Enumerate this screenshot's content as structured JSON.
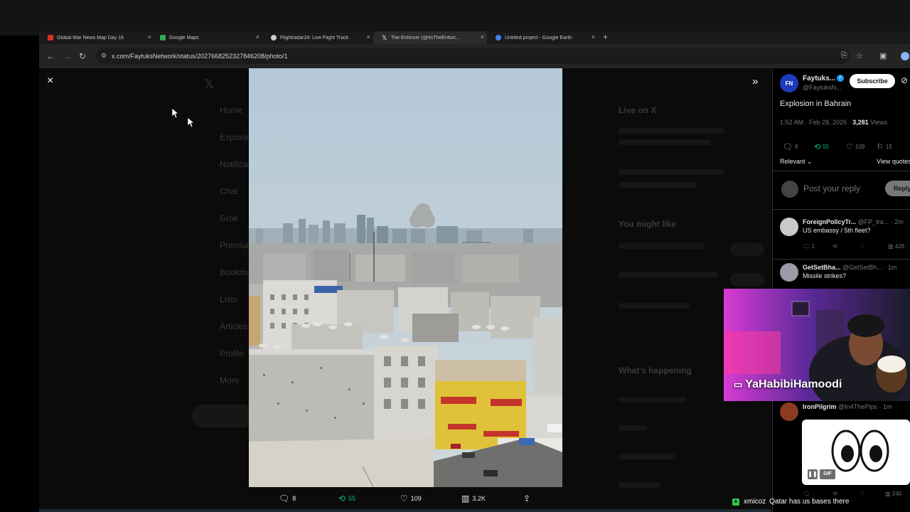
{
  "browser": {
    "tabs": [
      {
        "label": "Global War News Map Day 16",
        "color": "#d93025",
        "active": false
      },
      {
        "label": "Google Maps",
        "color": "#34a853",
        "active": false
      },
      {
        "label": "Flightradar24: Live Flight Track",
        "color": "#cccccc",
        "active": false
      },
      {
        "label": "The Enforcer (@ItsTheEnforcer)",
        "color": "#ffffff",
        "active": true
      },
      {
        "label": "Untitled project - Google Earth",
        "color": "#4285f4",
        "active": false
      }
    ],
    "new_tab": "+",
    "url": "x.com/FaytuksNetwork/status/2027668252327846208/photo/1"
  },
  "viewer": {
    "close_icon": "×",
    "expand_icon": "»",
    "photo_alt": "Explosion in Bahrain",
    "actions": {
      "replies": "8",
      "reposts": "55",
      "likes": "109",
      "views": "3.2K"
    }
  },
  "post": {
    "avatar_text": "FN",
    "author": "Faytuks...",
    "handle": "@FaytuksN...",
    "subscribe": "Subscribe",
    "text": "Explosion in Bahrain",
    "time": "1:52 AM · Feb 28, 2026 · ",
    "views_count": "3,281",
    "views_label": " Views",
    "stats": {
      "replies": "8",
      "reposts": "55",
      "likes": "109",
      "bookmarks": "15"
    },
    "sort_label": "Relevant ⌄",
    "view_quotes": "View quotes",
    "reply_placeholder": "Post your reply",
    "reply_button": "Reply"
  },
  "replies": [
    {
      "name": "ForeignPolicyTr...",
      "handle": "@FP_tra...",
      "time": "· 2m",
      "text": "US embassy / 5th fleet?",
      "replies": "1",
      "likes": "",
      "views": "428",
      "avatar_color": "#c9c9c9"
    },
    {
      "name": "GetSetBha...",
      "handle": "@GetSetBh...",
      "time": "· 1m",
      "text": "Missile strikes?",
      "replies": "",
      "likes": "",
      "views": "",
      "avatar_color": "#9a9aa8"
    },
    {
      "name": "IronPilgrim",
      "handle": "@In4ThePips",
      "time": "· 1m",
      "text": "",
      "replies": "",
      "likes": "",
      "views": "240",
      "avatar_color": "#8a3b22"
    }
  ],
  "overlay": {
    "streamer": "YaHabibiHamoodi",
    "gif_badge": "GIF",
    "chat_user": "xmicoz",
    "chat_message": "Qatar has us bases there"
  },
  "background_ghost": {
    "nav": [
      "Home",
      "Explore",
      "Notifications",
      "Chat",
      "Grok",
      "Premium",
      "Bookmarks",
      "Lists",
      "Articles",
      "Profile",
      "More"
    ],
    "right_headings": [
      "Live on X",
      "You might like",
      "What's happening"
    ]
  }
}
